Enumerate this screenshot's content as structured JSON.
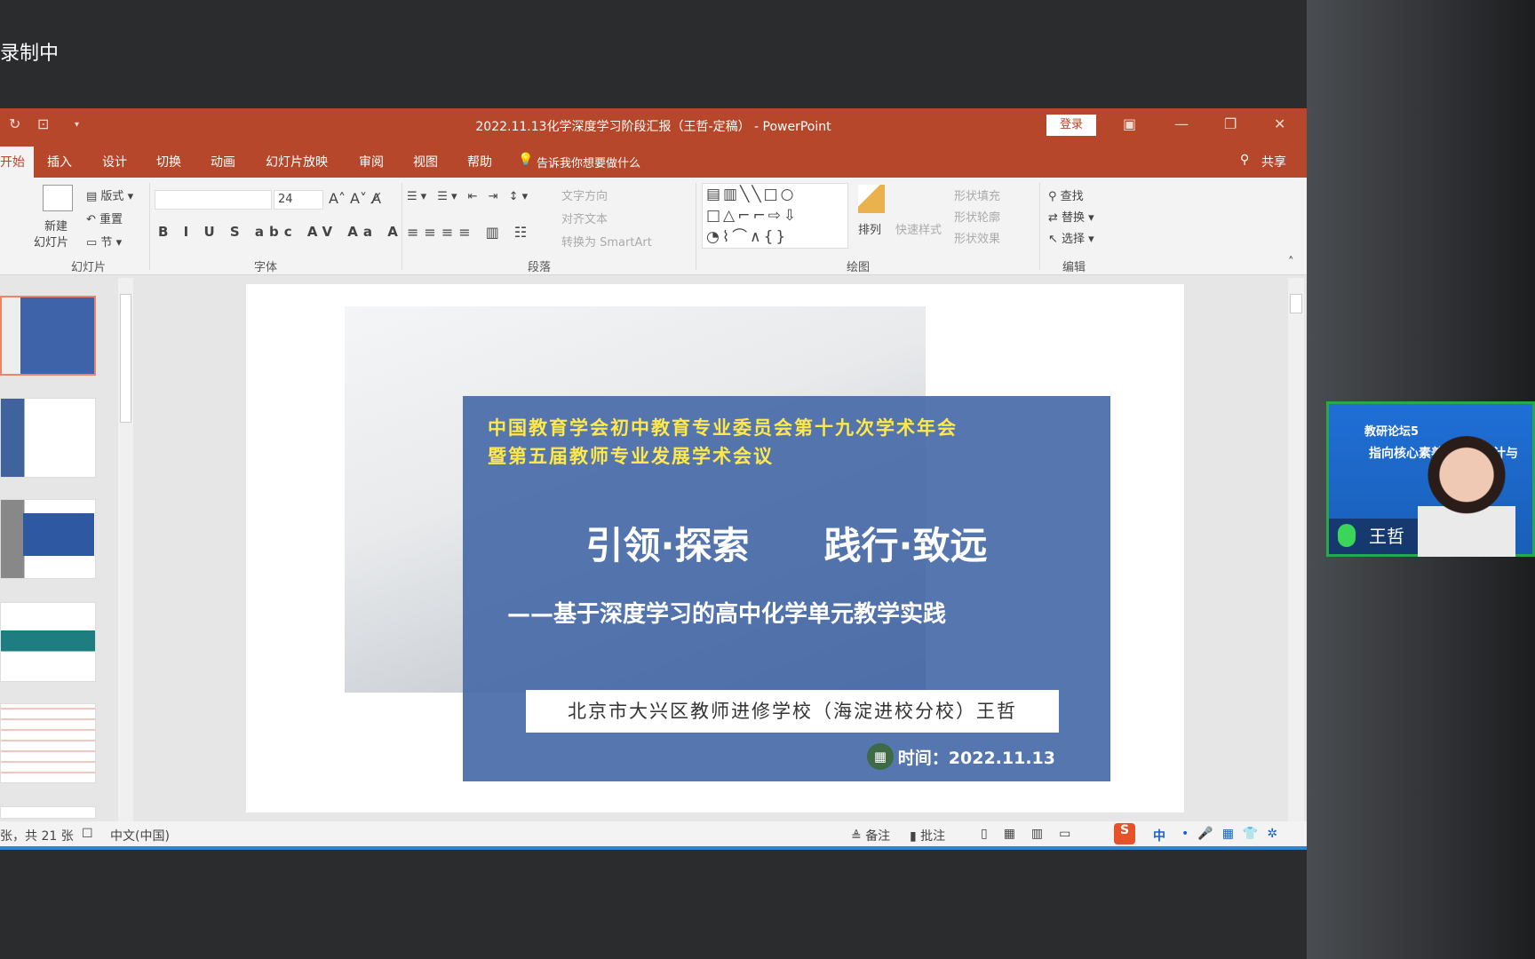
{
  "recording": "录制中",
  "window": {
    "title": "2022.11.13化学深度学习阶段汇报（王哲-定稿） - PowerPoint",
    "login": "登录",
    "share": "共享"
  },
  "tabs": [
    "开始",
    "插入",
    "设计",
    "切换",
    "动画",
    "幻灯片放映",
    "审阅",
    "视图",
    "帮助"
  ],
  "tell_me": "告诉我你想要做什么",
  "ribbon": {
    "slides": {
      "new_slide": "新建",
      "new_slide2": "幻灯片",
      "layout": "版式",
      "reset": "重置",
      "section": "节",
      "group": "幻灯片"
    },
    "font": {
      "size": "24",
      "group": "字体"
    },
    "paragraph": {
      "text_direction": "文字方向",
      "align_text": "对齐文本",
      "smartart": "转换为 SmartArt",
      "group": "段落"
    },
    "drawing": {
      "arrange": "排列",
      "quick_styles": "快速样式",
      "fill": "形状填充",
      "outline": "形状轮廓",
      "effects": "形状效果",
      "group": "绘图"
    },
    "editing": {
      "find": "查找",
      "replace": "替换",
      "select": "选择",
      "group": "编辑"
    }
  },
  "slide": {
    "org_line1": "中国教育学会初中教育专业委员会第十九次学术年会",
    "org_line2": "暨第五届教师专业发展学术会议",
    "title": "引领·探索　　践行·致远",
    "subtitle": "——基于深度学习的高中化学单元教学实践",
    "institution": "北京市大兴区教师进修学校（海淀进校分校）王哲",
    "date": "时间：2022.11.13"
  },
  "status": {
    "slide_count": "张，共 21 张",
    "language": "中文(中国)",
    "notes": "备注",
    "comments": "批注",
    "ime": "中"
  },
  "video": {
    "name": "王哲",
    "bg_line1": "教研论坛5",
    "bg_line2": "指向核心素养的教学设计与"
  },
  "colors": {
    "accent": "#b7472a",
    "slide_blue": "#486aa8",
    "title_yellow": "#ffe94a",
    "speaker_border": "#27a84a"
  }
}
